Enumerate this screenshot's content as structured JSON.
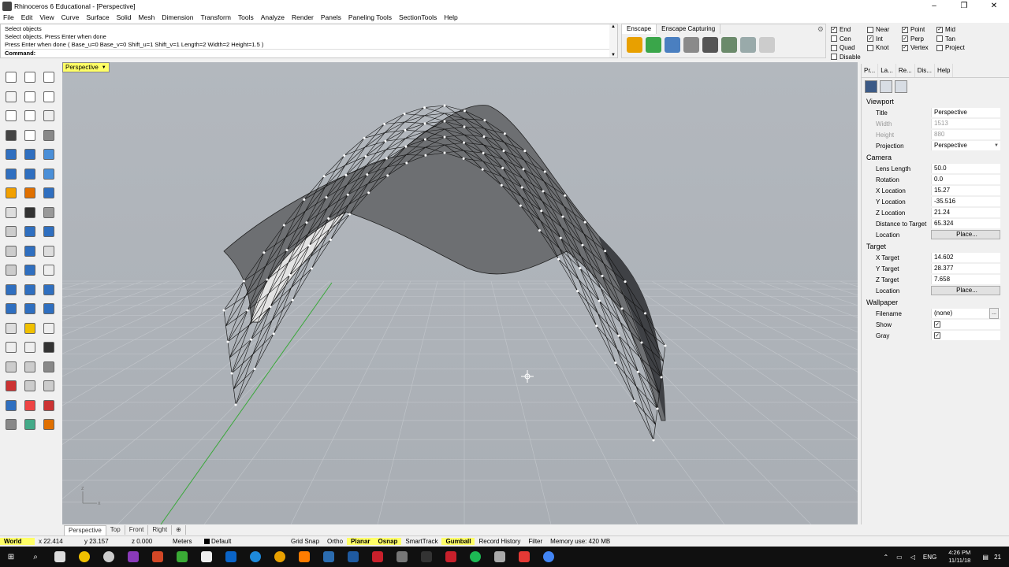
{
  "window": {
    "title": "Rhinoceros 6 Educational - [Perspective]"
  },
  "menu": [
    "File",
    "Edit",
    "View",
    "Curve",
    "Surface",
    "Solid",
    "Mesh",
    "Dimension",
    "Transform",
    "Tools",
    "Analyze",
    "Render",
    "Panels",
    "Paneling Tools",
    "SectionTools",
    "Help"
  ],
  "command": {
    "lines": [
      "Select objects",
      "Select objects. Press Enter when done",
      "Press Enter when done ( Base_u=0  Base_v=0  Shift_u=1  Shift_v=1  Length=2  Width=2  Height=1.5 )"
    ],
    "prompt": "Command:"
  },
  "enscape": {
    "tabs": [
      "Enscape",
      "Enscape Capturing"
    ]
  },
  "osnap": [
    {
      "label": "End",
      "checked": true
    },
    {
      "label": "Near",
      "checked": false
    },
    {
      "label": "Point",
      "checked": true
    },
    {
      "label": "Mid",
      "checked": true
    },
    {
      "label": "Cen",
      "checked": false
    },
    {
      "label": "Int",
      "checked": true
    },
    {
      "label": "Perp",
      "checked": true
    },
    {
      "label": "Tan",
      "checked": false
    },
    {
      "label": "Quad",
      "checked": false
    },
    {
      "label": "Knot",
      "checked": false
    },
    {
      "label": "Vertex",
      "checked": true
    },
    {
      "label": "Project",
      "checked": false
    },
    {
      "label": "Disable",
      "checked": false
    }
  ],
  "viewport": {
    "label": "Perspective",
    "tabs": [
      "Perspective",
      "Top",
      "Front",
      "Right"
    ]
  },
  "panel": {
    "tabs": [
      "Pr...",
      "La...",
      "Re...",
      "Dis...",
      "Help"
    ],
    "viewport_section": "Viewport",
    "title_label": "Title",
    "title_value": "Perspective",
    "width_label": "Width",
    "width_value": "1513",
    "height_label": "Height",
    "height_value": "880",
    "projection_label": "Projection",
    "projection_value": "Perspective",
    "camera_section": "Camera",
    "lens_label": "Lens Length",
    "lens_value": "50.0",
    "rotation_label": "Rotation",
    "rotation_value": "0.0",
    "xloc_label": "X Location",
    "xloc_value": "15.27",
    "yloc_label": "Y Location",
    "yloc_value": "-35.516",
    "zloc_label": "Z Location",
    "zloc_value": "21.24",
    "dist_label": "Distance to Target",
    "dist_value": "65.324",
    "location_label": "Location",
    "place_label": "Place...",
    "target_section": "Target",
    "xt_label": "X Target",
    "xt_value": "14.602",
    "yt_label": "Y Target",
    "yt_value": "28.377",
    "zt_label": "Z Target",
    "zt_value": "7.658",
    "tlocation_label": "Location",
    "tplace_label": "Place...",
    "wallpaper_section": "Wallpaper",
    "filename_label": "Filename",
    "filename_value": "(none)",
    "show_label": "Show",
    "gray_label": "Gray"
  },
  "status": {
    "cplane": "World",
    "x": "x 22.414",
    "y": "y 23.157",
    "z": "z 0.000",
    "units": "Meters",
    "layer": "Default",
    "grid_snap": "Grid Snap",
    "ortho": "Ortho",
    "planar": "Planar",
    "osnap": "Osnap",
    "smarttrack": "SmartTrack",
    "gumball": "Gumball",
    "record": "Record History",
    "filter": "Filter",
    "memory": "Memory use: 420 MB"
  },
  "taskbar": {
    "lang": "ENG",
    "time": "4:26 PM",
    "date": "11/11/18",
    "notif": "21"
  }
}
